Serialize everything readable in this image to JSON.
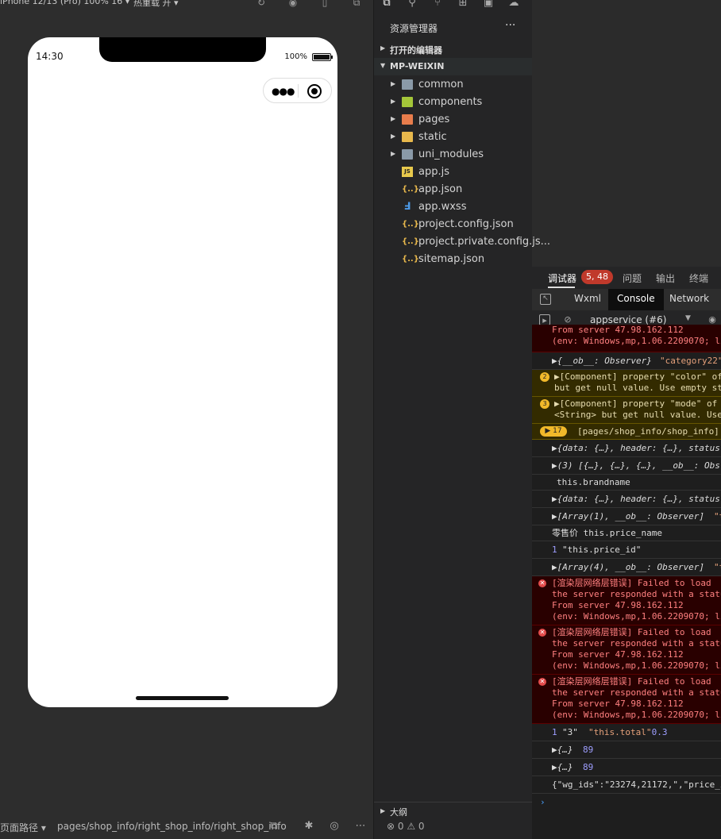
{
  "simulator": {
    "device_label": "iPhone 12/13 (Pro) 100% 16 ▾",
    "hot_reload_label": "热重载 开 ▾",
    "phone": {
      "time": "14:30",
      "battery": "100%"
    },
    "status_bar": {
      "path_label": "页面路径 ▾",
      "path": "pages/shop_info/right_shop_info/right_shop_info"
    }
  },
  "explorer": {
    "title": "资源管理器",
    "more": "···",
    "open_editors": "打开的编辑器",
    "project": "MP-WEIXIN",
    "items": [
      {
        "label": "common",
        "type": "folder",
        "color": "#8a9aa8"
      },
      {
        "label": "components",
        "type": "folder",
        "color": "#a4c639"
      },
      {
        "label": "pages",
        "type": "folder",
        "color": "#e87d4c"
      },
      {
        "label": "static",
        "type": "folder",
        "color": "#e8b84c"
      },
      {
        "label": "uni_modules",
        "type": "folder",
        "color": "#8a9aa8"
      },
      {
        "label": "app.js",
        "type": "js",
        "color": "#e8c94c"
      },
      {
        "label": "app.json",
        "type": "json",
        "color": "#e8b84c"
      },
      {
        "label": "app.wxss",
        "type": "css",
        "color": "#4c9ae8"
      },
      {
        "label": "project.config.json",
        "type": "json",
        "color": "#e8b84c"
      },
      {
        "label": "project.private.config.js...",
        "type": "json",
        "color": "#e8b84c"
      },
      {
        "label": "sitemap.json",
        "type": "json",
        "color": "#e8b84c"
      }
    ],
    "outline": "大纲",
    "counts": "⊗ 0 ⚠ 0"
  },
  "debugger": {
    "tabs": [
      "调试器",
      "问题",
      "输出",
      "终端"
    ],
    "badge": "5, 48",
    "panel_tabs": [
      "Wxml",
      "Console",
      "Network"
    ],
    "context": "appservice (#6)",
    "console": {
      "r0": {
        "a": "From server 47.98.162.112",
        "b": "(env: Windows,mp,1.06.2209070; li"
      },
      "r1": {
        "a": "▶{__ob__: Observer} ",
        "b": "\"category22\""
      },
      "r2": {
        "n": "2",
        "a": "▶[Component] property \"color\" of",
        "b": "but get null value. Use empty st"
      },
      "r3": {
        "n": "3",
        "a": "▶[Component] property \"mode\" of",
        "b": "<String> but get null value. Use"
      },
      "r4": {
        "n": "▶ 17",
        "a": "[pages/shop_info/shop_info]"
      },
      "r5": {
        "a": "▶{data: {…}, header: {…}, status"
      },
      "r6": {
        "a": "▶(3) [{…}, {…}, {…}, __ob__: Obs"
      },
      "r7": {
        "a": "this.brandname"
      },
      "r8": {
        "a": "▶{data: {…}, header: {…}, status"
      },
      "r9": {
        "a": "▶[Array(1), __ob__: Observer] ",
        "b": "\"t"
      },
      "r10": {
        "a": "零售价 this.price_name"
      },
      "r11": {
        "n": "1",
        "a": "\"this.price_id\""
      },
      "r12": {
        "a": "▶[Array(4), __ob__: Observer] ",
        "b": "\"t"
      },
      "r13": {
        "a": "[渲染层网络层错误] Failed to load",
        "b": "the server responded with a statu",
        "c": "From server 47.98.162.112",
        "d": "(env: Windows,mp,1.06.2209070; li"
      },
      "r14": {
        "a": "[渲染层网络层错误] Failed to load",
        "b": "the server responded with a statu",
        "c": "From server 47.98.162.112",
        "d": "(env: Windows,mp,1.06.2209070; li"
      },
      "r15": {
        "a": "[渲染层网络层错误] Failed to load",
        "b": "the server responded with a statu",
        "c": "From server 47.98.162.112",
        "d": "(env: Windows,mp,1.06.2209070; li"
      },
      "r16": {
        "n": "1",
        "a": "\"3\" ",
        "b": "\"this.total\"",
        "c": " 0.3"
      },
      "r17": {
        "a": "▶{…} ",
        "b": "89"
      },
      "r18": {
        "a": "▶{…} ",
        "b": "89"
      },
      "r19": {
        "a": "{\"wg_ids\":\"23274,21172,\",\"price_i"
      }
    }
  }
}
